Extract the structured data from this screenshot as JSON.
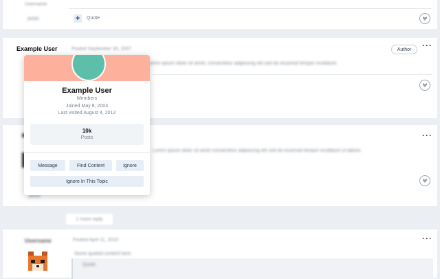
{
  "post_top": {
    "author_blurred": "Username",
    "meta_blurred": "posts",
    "quote_label": "Quote"
  },
  "post_main": {
    "author": "Example User",
    "badge": "Author",
    "date_blurred": "Posted September 30, 2007",
    "content_blurred": "Lorem ipsum dolor sit amet, consectetur adipiscing elit sed do eiusmod tempor incididunt."
  },
  "post_third": {
    "content_blurred": "Lorem ipsum dolor sit amet consectetur adipiscing elit sed do eiusmod tempor incididunt ut labore.",
    "meta_blurred": "posts"
  },
  "pagination_blurred": "1 more reply",
  "post_fourth": {
    "author_blurred": "Username",
    "date_blurred": "Posted April 11, 2010",
    "content_blurred": "Some quoted content here",
    "quote_blurred": "Quote"
  },
  "popup": {
    "name": "Example User",
    "role": "Members",
    "joined": "Joined May 8, 2003",
    "last_visited": "Last visited August 4, 2012",
    "posts_count": "10k",
    "posts_label": "Posts",
    "buttons": {
      "message": "Message",
      "find_content": "Find Content",
      "ignore": "Ignore",
      "ignore_topic": "Ignore In This Topic"
    }
  },
  "icons": {
    "heart": "heart-icon",
    "more": "more-options-icon",
    "plus": "plus-icon"
  },
  "colors": {
    "banner": "#fdb09b",
    "avatar": "#5dbfaa",
    "button_bg": "#e7eef6",
    "page_bg": "#ebeef2"
  }
}
